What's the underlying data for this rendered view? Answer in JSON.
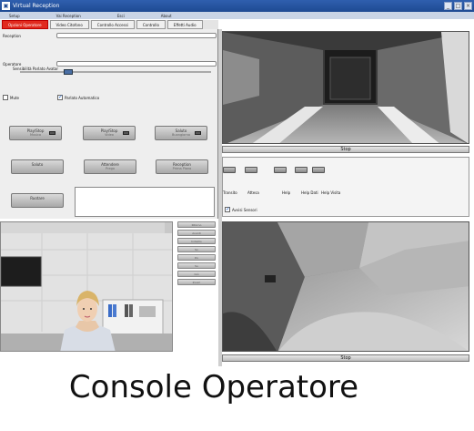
{
  "window": {
    "title": "Virtual Reception",
    "app_icon": "app-icon",
    "controls": [
      "_",
      "□",
      "×"
    ]
  },
  "menu": [
    "Setup",
    "Vai Reception",
    "Esci",
    "About"
  ],
  "tabs": [
    {
      "label": "Opzioni Operatore",
      "active": true
    },
    {
      "label": "Video Citofono",
      "active": false
    },
    {
      "label": "Controllo Accessi",
      "active": false
    },
    {
      "label": "Controllo",
      "active": false
    },
    {
      "label": "Effetti Audio",
      "active": false
    }
  ],
  "left": {
    "reception_label": "Reception",
    "reception_value": "",
    "operatore_label": "Operatore",
    "operatore_value": "",
    "sensibilita_label": "Sensibilità Parlato Avatar",
    "sensibilita_level": 0.24,
    "mute_label": "Mute",
    "mute_checked": false,
    "parlato_label": "Parlato Automatico",
    "parlato_checked": true,
    "buttons_row1": [
      {
        "label": "Play/Stop",
        "sub": "Musica"
      },
      {
        "label": "Play/Stop",
        "sub": "Video"
      },
      {
        "label": "Saluto",
        "sub": "Buongiorno"
      }
    ],
    "buttons_row2": [
      {
        "label": "Saluto",
        "sub": ""
      },
      {
        "label": "Attendere",
        "sub": "Prego"
      },
      {
        "label": "Reception",
        "sub": "Prima Piano"
      }
    ],
    "button_row3": {
      "label": "Ruotare",
      "sub": ""
    }
  },
  "cameras": {
    "cam1_stop": "Stop",
    "cam2_stop": "Stop"
  },
  "middle": {
    "labels": [
      "Transito",
      "Attesa",
      "Help",
      "Help Dati",
      "Help Visita"
    ],
    "avvisi_label": "Avvisi Sensori",
    "avvisi_checked": true
  },
  "side_buttons": [
    "Ritorno",
    "Avanti",
    "Indietro",
    "Sx",
    "Dx",
    "Su",
    "Giù",
    "Zoom"
  ],
  "caption": "Console Operatore"
}
